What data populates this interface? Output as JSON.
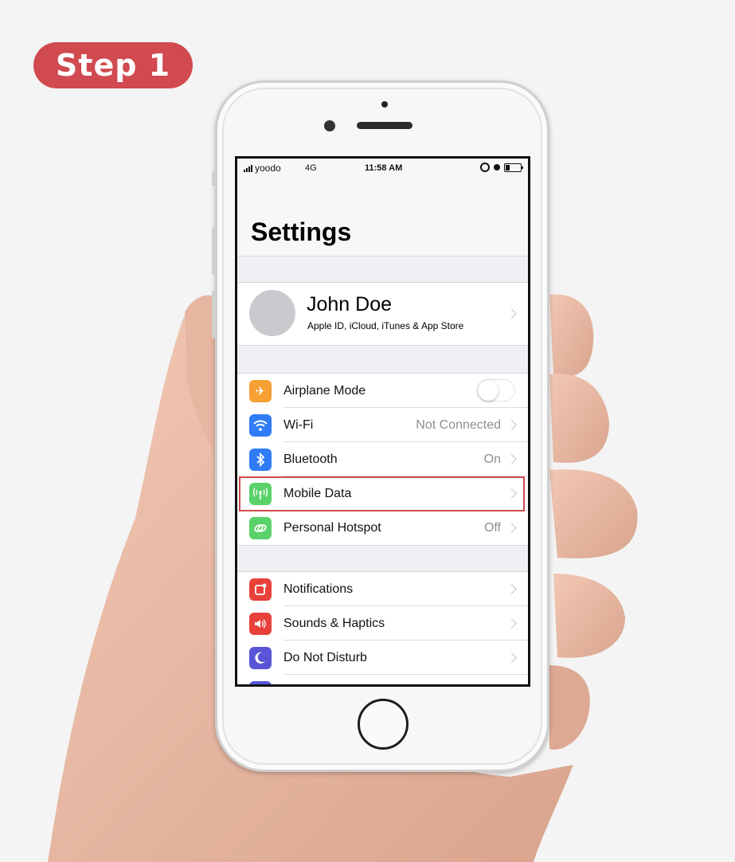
{
  "badge": {
    "label": "Step 1"
  },
  "status_bar": {
    "carrier": "yoodo",
    "network": "4G",
    "time": "11:58 AM"
  },
  "page": {
    "title": "Settings"
  },
  "profile": {
    "name": "John Doe",
    "subtitle": "Apple ID, iCloud, iTunes & App Store"
  },
  "group1": {
    "items": [
      {
        "label": "Airplane Mode",
        "icon": "airplane-icon",
        "color": "#f7a033",
        "toggle_on": false
      },
      {
        "label": "Wi-Fi",
        "value": "Not Connected",
        "icon": "wifi-icon",
        "color": "#2f7cf6"
      },
      {
        "label": "Bluetooth",
        "value": "On",
        "icon": "bluetooth-icon",
        "color": "#2f7cf6"
      },
      {
        "label": "Mobile Data",
        "icon": "antenna-icon",
        "color": "#5bd16a",
        "highlighted": true
      },
      {
        "label": "Personal Hotspot",
        "value": "Off",
        "icon": "hotspot-link-icon",
        "color": "#5bd16a"
      }
    ]
  },
  "group2": {
    "items": [
      {
        "label": "Notifications",
        "icon": "notifications-icon",
        "color": "#e8413a"
      },
      {
        "label": "Sounds & Haptics",
        "icon": "speaker-icon",
        "color": "#e8413a"
      },
      {
        "label": "Do Not Disturb",
        "icon": "moon-icon",
        "color": "#5856d6"
      }
    ]
  },
  "colors": {
    "badge": "#d04a4f",
    "highlight": "#d04a4f"
  }
}
